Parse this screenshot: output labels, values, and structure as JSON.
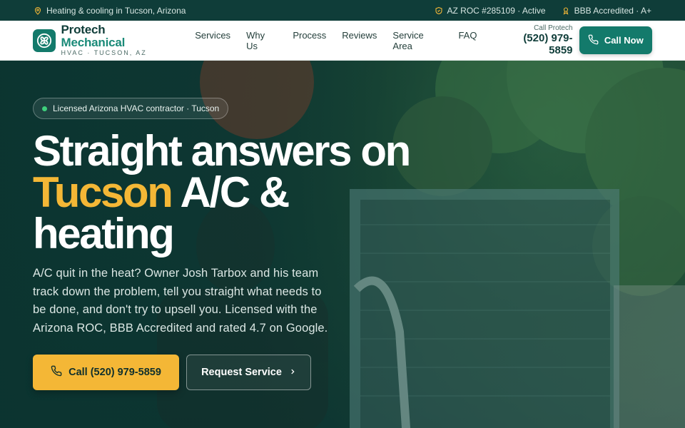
{
  "topbar": {
    "location": "Heating & cooling in Tucson, Arizona",
    "license": "AZ ROC #285109 · Active",
    "bbb": "BBB Accredited · A+"
  },
  "brand": {
    "name_part1": "Protech",
    "name_part2": "Mechanical",
    "tagline": "HVAC · TUCSON, AZ"
  },
  "nav": {
    "items": [
      "Services",
      "Why Us",
      "Process",
      "Reviews",
      "Service Area",
      "FAQ"
    ]
  },
  "header_phone": {
    "caption": "Call Protech",
    "number": "(520) 979-5859"
  },
  "call_now_label": "Call Now",
  "hero": {
    "badge": "Licensed Arizona HVAC contractor · Tucson",
    "headline_line1": "Straight answers on",
    "headline_accent": "Tucson",
    "headline_line2_rest": "A/C &",
    "headline_line3": "heating",
    "lede": "A/C quit in the heat? Owner Josh Tarbox and his team track down the problem, tell you straight what needs to be done, and don't try to upsell you. Licensed with the Arizona ROC, BBB Accredited and rated 4.7 on Google.",
    "primary_cta": "Call (520) 979-5859",
    "secondary_cta": "Request Service"
  },
  "colors": {
    "brand_teal": "#137a6b",
    "dark_teal": "#0f3d39",
    "accent_yellow": "#f4b736"
  },
  "icons": [
    "map-pin-icon",
    "shield-icon",
    "award-icon",
    "fan-logo-icon",
    "phone-icon",
    "chevron-right-icon"
  ]
}
